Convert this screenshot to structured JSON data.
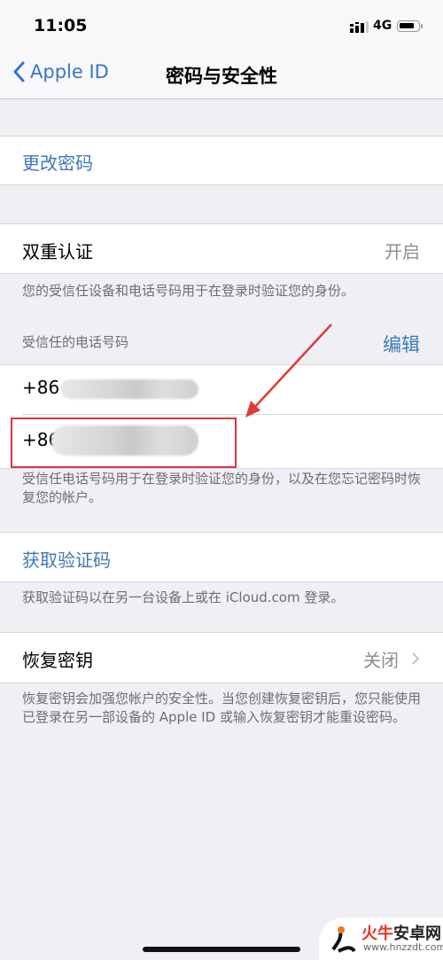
{
  "status_bar": {
    "time": "11:05",
    "network": "4G",
    "icons": [
      "signal-icon",
      "battery-icon"
    ]
  },
  "nav": {
    "back_label": "Apple ID",
    "title": "密码与安全性"
  },
  "change_password": {
    "label": "更改密码"
  },
  "two_factor": {
    "label": "双重认证",
    "value": "开启",
    "description": "您的受信任设备和电话号码用于在登录时验证您的身份。",
    "trusted_numbers_header": "受信任的电话号码",
    "edit_label": "编辑",
    "phone_numbers": [
      {
        "prefix": "+86"
      },
      {
        "prefix": "+86"
      }
    ],
    "phone_footer": "受信任电话号码用于在登录时验证您的身份，以及在您忘记密码时恢复您的帐户。"
  },
  "verification": {
    "label": "获取验证码",
    "footer": "获取验证码以在另一台设备上或在 iCloud.com 登录。"
  },
  "recovery_key": {
    "label": "恢复密钥",
    "value": "关闭",
    "footer": "恢复密钥会加强您帐户的安全性。当您创建恢复密钥后，您只能使用已登录在另一部设备的 Apple ID 或输入恢复密钥才能重设密码。"
  },
  "annotation": {
    "color": "#d9363e"
  },
  "watermark": {
    "brand_red": "火牛",
    "brand": "安卓网",
    "url": "www.hnzzdt.com"
  },
  "colors": {
    "accent": "#3d7ab8",
    "background": "#efeff4",
    "secondary_text": "#8e8e93"
  }
}
